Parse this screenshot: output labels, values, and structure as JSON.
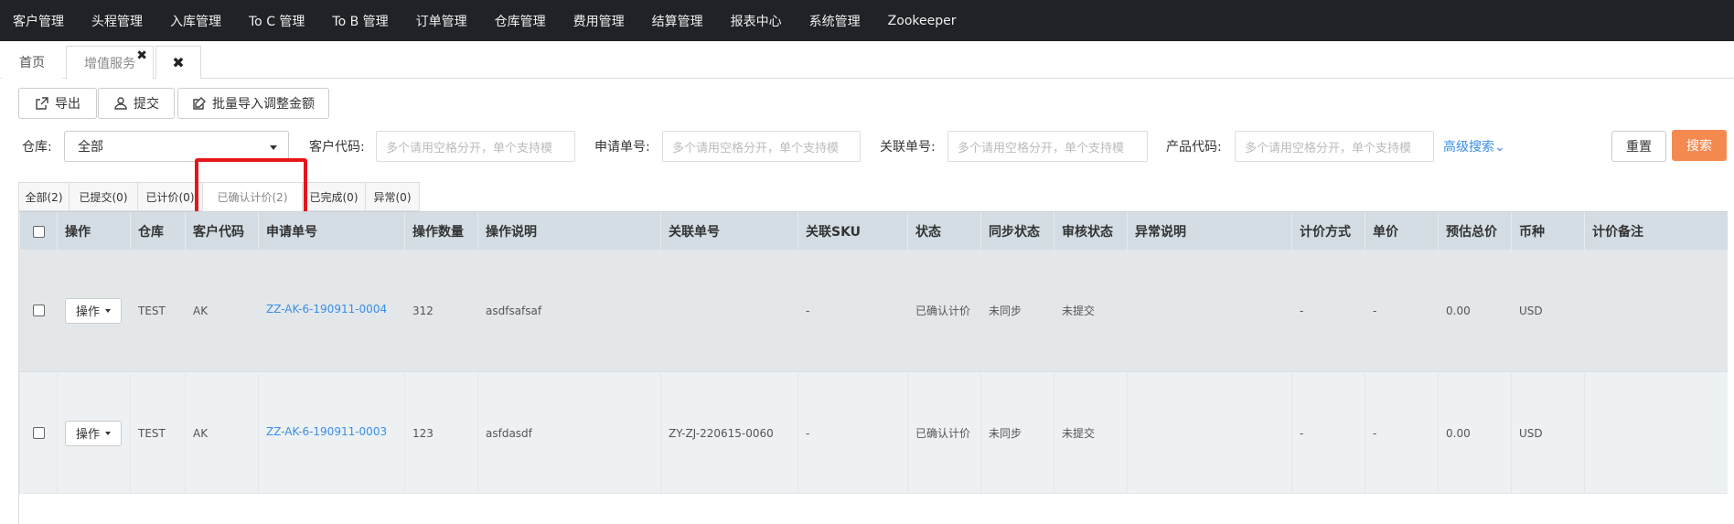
{
  "nav": [
    "客户管理",
    "头程管理",
    "入库管理",
    "To C 管理",
    "To B 管理",
    "订单管理",
    "仓库管理",
    "费用管理",
    "结算管理",
    "报表中心",
    "系统管理",
    "Zookeeper"
  ],
  "page_tabs": {
    "home": "首页",
    "active": "增值服务",
    "close": "✖",
    "close_all": "✖"
  },
  "toolbar": {
    "export": "导出",
    "submit": "提交",
    "batch_import": "批量导入调整金额"
  },
  "filters": {
    "warehouse_label": "仓库:",
    "warehouse_value": "全部",
    "customer_code_label": "客户代码:",
    "customer_code_placeholder": "多个请用空格分开，单个支持模",
    "request_no_label": "申请单号:",
    "request_no_placeholder": "多个请用空格分开，单个支持模",
    "related_no_label": "关联单号:",
    "related_no_placeholder": "多个请用空格分开，单个支持模",
    "product_code_label": "产品代码:",
    "product_code_placeholder": "多个请用空格分开，单个支持模",
    "advanced": "高级搜索⌄",
    "reset": "重置",
    "search": "搜索"
  },
  "status_tabs": [
    "全部(2)",
    "已提交(0)",
    "已计价(0)",
    "已确认计价(2)",
    "已完成(0)",
    "异常(0)"
  ],
  "table": {
    "headers": [
      "操作",
      "仓库",
      "客户代码",
      "申请单号",
      "操作数量",
      "操作说明",
      "关联单号",
      "关联SKU",
      "状态",
      "同步状态",
      "审核状态",
      "异常说明",
      "计价方式",
      "单价",
      "预估总价",
      "币种",
      "计价备注"
    ],
    "op_label": "操作",
    "rows": [
      {
        "warehouse": "TEST",
        "customer": "AK",
        "request_no": "ZZ-AK-6-190911-0004",
        "qty": "312",
        "desc": "asdfsafsaf",
        "related_no": "",
        "sku": "-",
        "status": "已确认计价",
        "sync": "未同步",
        "audit": "未提交",
        "exception": "",
        "pricing": "-",
        "unit_price": "-",
        "total": "0.00",
        "currency": "USD",
        "remark": ""
      },
      {
        "warehouse": "TEST",
        "customer": "AK",
        "request_no": "ZZ-AK-6-190911-0003",
        "qty": "123",
        "desc": "asfdasdf",
        "related_no": "ZY-ZJ-220615-0060",
        "sku": "-",
        "status": "已确认计价",
        "sync": "未同步",
        "audit": "未提交",
        "exception": "",
        "pricing": "-",
        "unit_price": "-",
        "total": "0.00",
        "currency": "USD",
        "remark": ""
      }
    ]
  }
}
